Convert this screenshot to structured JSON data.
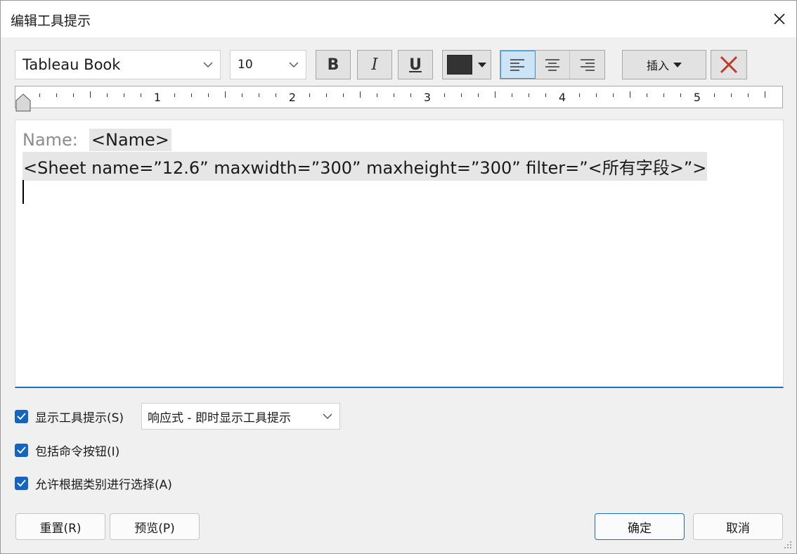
{
  "window": {
    "title": "编辑工具提示"
  },
  "toolbar": {
    "font_family": "Tableau Book",
    "font_size": "10",
    "bold_label": "B",
    "italic_label": "I",
    "underline_label": "U",
    "text_color": "#333333",
    "alignment": "left",
    "insert_label": "插入"
  },
  "ruler": {
    "labels": [
      "1",
      "2",
      "3",
      "4",
      "5"
    ]
  },
  "editor": {
    "name_label": "Name:",
    "name_field": "<Name>",
    "sheet_markup": "<Sheet name=”12.6” maxwidth=”300” maxheight=”300” filter=”<所有字段>”>"
  },
  "options": {
    "show_tooltip": {
      "label": "显示工具提示(S)",
      "checked": true
    },
    "tooltip_mode": "响应式 - 即时显示工具提示",
    "include_commands": {
      "label": "包括命令按钮(I)",
      "checked": true
    },
    "allow_category_select": {
      "label": "允许根据类别进行选择(A)",
      "checked": true
    }
  },
  "buttons": {
    "reset": "重置(R)",
    "preview": "预览(P)",
    "ok": "确定",
    "cancel": "取消"
  },
  "colors": {
    "accent": "#1f6fc0",
    "checkbox": "#1565c0",
    "delete_x": "#c0392b"
  }
}
